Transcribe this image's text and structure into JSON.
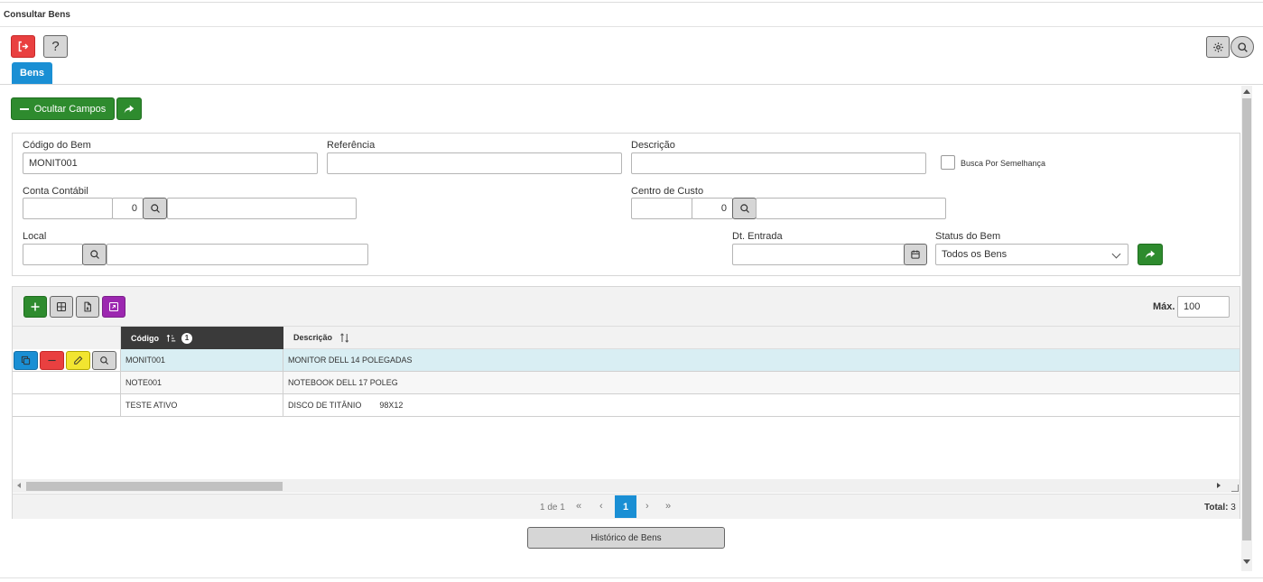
{
  "window": {
    "title": "Consultar Bens"
  },
  "toolbar": {
    "exit_icon": "exit-icon",
    "help_label": "?",
    "gear_icon": "gear-icon",
    "search_icon": "search-icon"
  },
  "tabs": [
    {
      "label": "Bens",
      "active": true
    }
  ],
  "actions": {
    "ocultar_label": "Ocultar Campos"
  },
  "form": {
    "codigo": {
      "label": "Código do Bem",
      "value": "MONIT001"
    },
    "referencia": {
      "label": "Referência",
      "value": ""
    },
    "descricao": {
      "label": "Descrição",
      "value": ""
    },
    "semelhanca": {
      "label": "Busca Por Semelhança",
      "checked": false
    },
    "conta": {
      "label": "Conta Contábil",
      "value1": "",
      "value2": "0",
      "value3": ""
    },
    "centro": {
      "label": "Centro de Custo",
      "value1": "",
      "value2": "0",
      "value3": ""
    },
    "local": {
      "label": "Local",
      "value1": "",
      "value2": ""
    },
    "dt_entrada": {
      "label": "Dt. Entrada",
      "value": ""
    },
    "status": {
      "label": "Status do Bem",
      "value": "Todos os Bens"
    }
  },
  "grid": {
    "max_label": "Máx.",
    "max_value": "100",
    "columns": {
      "codigo": "Código",
      "codigo_sort_order": "1",
      "descricao": "Descrição"
    },
    "rows": [
      {
        "codigo": "MONIT001",
        "descricao": "MONITOR DELL 14 POLEGADAS",
        "selected": true
      },
      {
        "codigo": "NOTE001",
        "descricao": "NOTEBOOK DELL 17 POLEG",
        "selected": false
      },
      {
        "codigo": "TESTE ATIVO",
        "descricao": "DISCO DE TITÂNIO        98X12",
        "selected": false
      }
    ],
    "pager": {
      "info": "1 de 1",
      "first": "«",
      "prev": "‹",
      "current": "1",
      "next": "›",
      "last": "»",
      "total_label": "Total:",
      "total_value": "3"
    }
  },
  "footer": {
    "historico_label": "Histórico de Bens"
  },
  "colors": {
    "primary": "#1a8fd4",
    "success": "#2e8b2e",
    "danger": "#e94040",
    "warning": "#f2e530",
    "purple": "#9c27b0"
  }
}
